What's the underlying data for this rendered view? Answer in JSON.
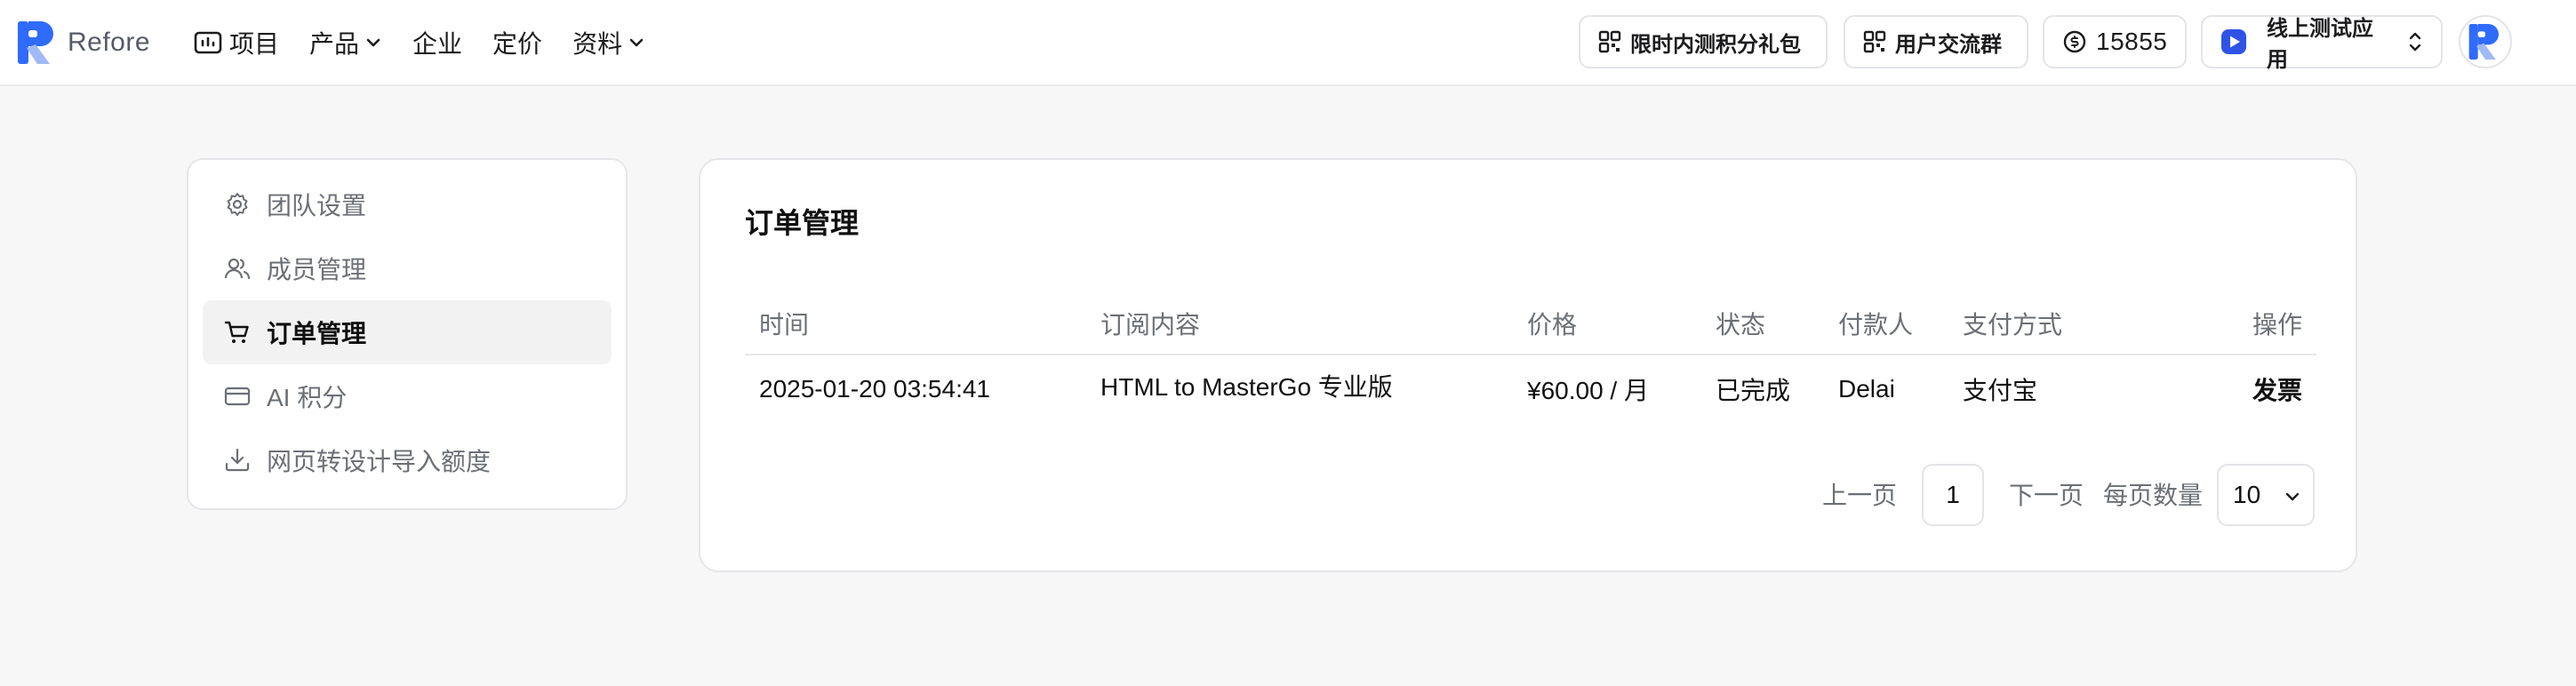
{
  "brand": {
    "name": "Refore",
    "accent": "#2f6bff"
  },
  "nav": {
    "items": [
      {
        "label": "项目",
        "icon": "folder-icon"
      },
      {
        "label": "产品",
        "icon": "chevron-down-icon"
      },
      {
        "label": "企业"
      },
      {
        "label": "定价"
      },
      {
        "label": "资料",
        "icon": "chevron-down-icon"
      }
    ]
  },
  "header": {
    "promo_label": "限时内测积分礼包",
    "community_label": "用户交流群",
    "credits": "15855",
    "app_label": "线上测试应用"
  },
  "sidebar": {
    "items": [
      {
        "label": "团队设置",
        "icon": "gear-icon"
      },
      {
        "label": "成员管理",
        "icon": "users-icon"
      },
      {
        "label": "订单管理",
        "icon": "cart-icon",
        "active": true
      },
      {
        "label": "AI 积分",
        "icon": "credit-card-icon"
      },
      {
        "label": "网页转设计导入额度",
        "icon": "download-icon"
      }
    ]
  },
  "orders": {
    "title": "订单管理",
    "columns": [
      "时间",
      "订阅内容",
      "价格",
      "状态",
      "付款人",
      "支付方式",
      "操作"
    ],
    "rows": [
      {
        "time": "2025-01-20 03:54:41",
        "content": "HTML to MasterGo 专业版",
        "price": "¥60.00 / 月",
        "status": "已完成",
        "payer": "Delai",
        "method": "支付宝",
        "action": "发票"
      }
    ],
    "pagination": {
      "prev": "上一页",
      "page": "1",
      "next": "下一页",
      "per_page_label": "每页数量",
      "per_page": "10"
    },
    "link_color": "#1f55d6"
  }
}
